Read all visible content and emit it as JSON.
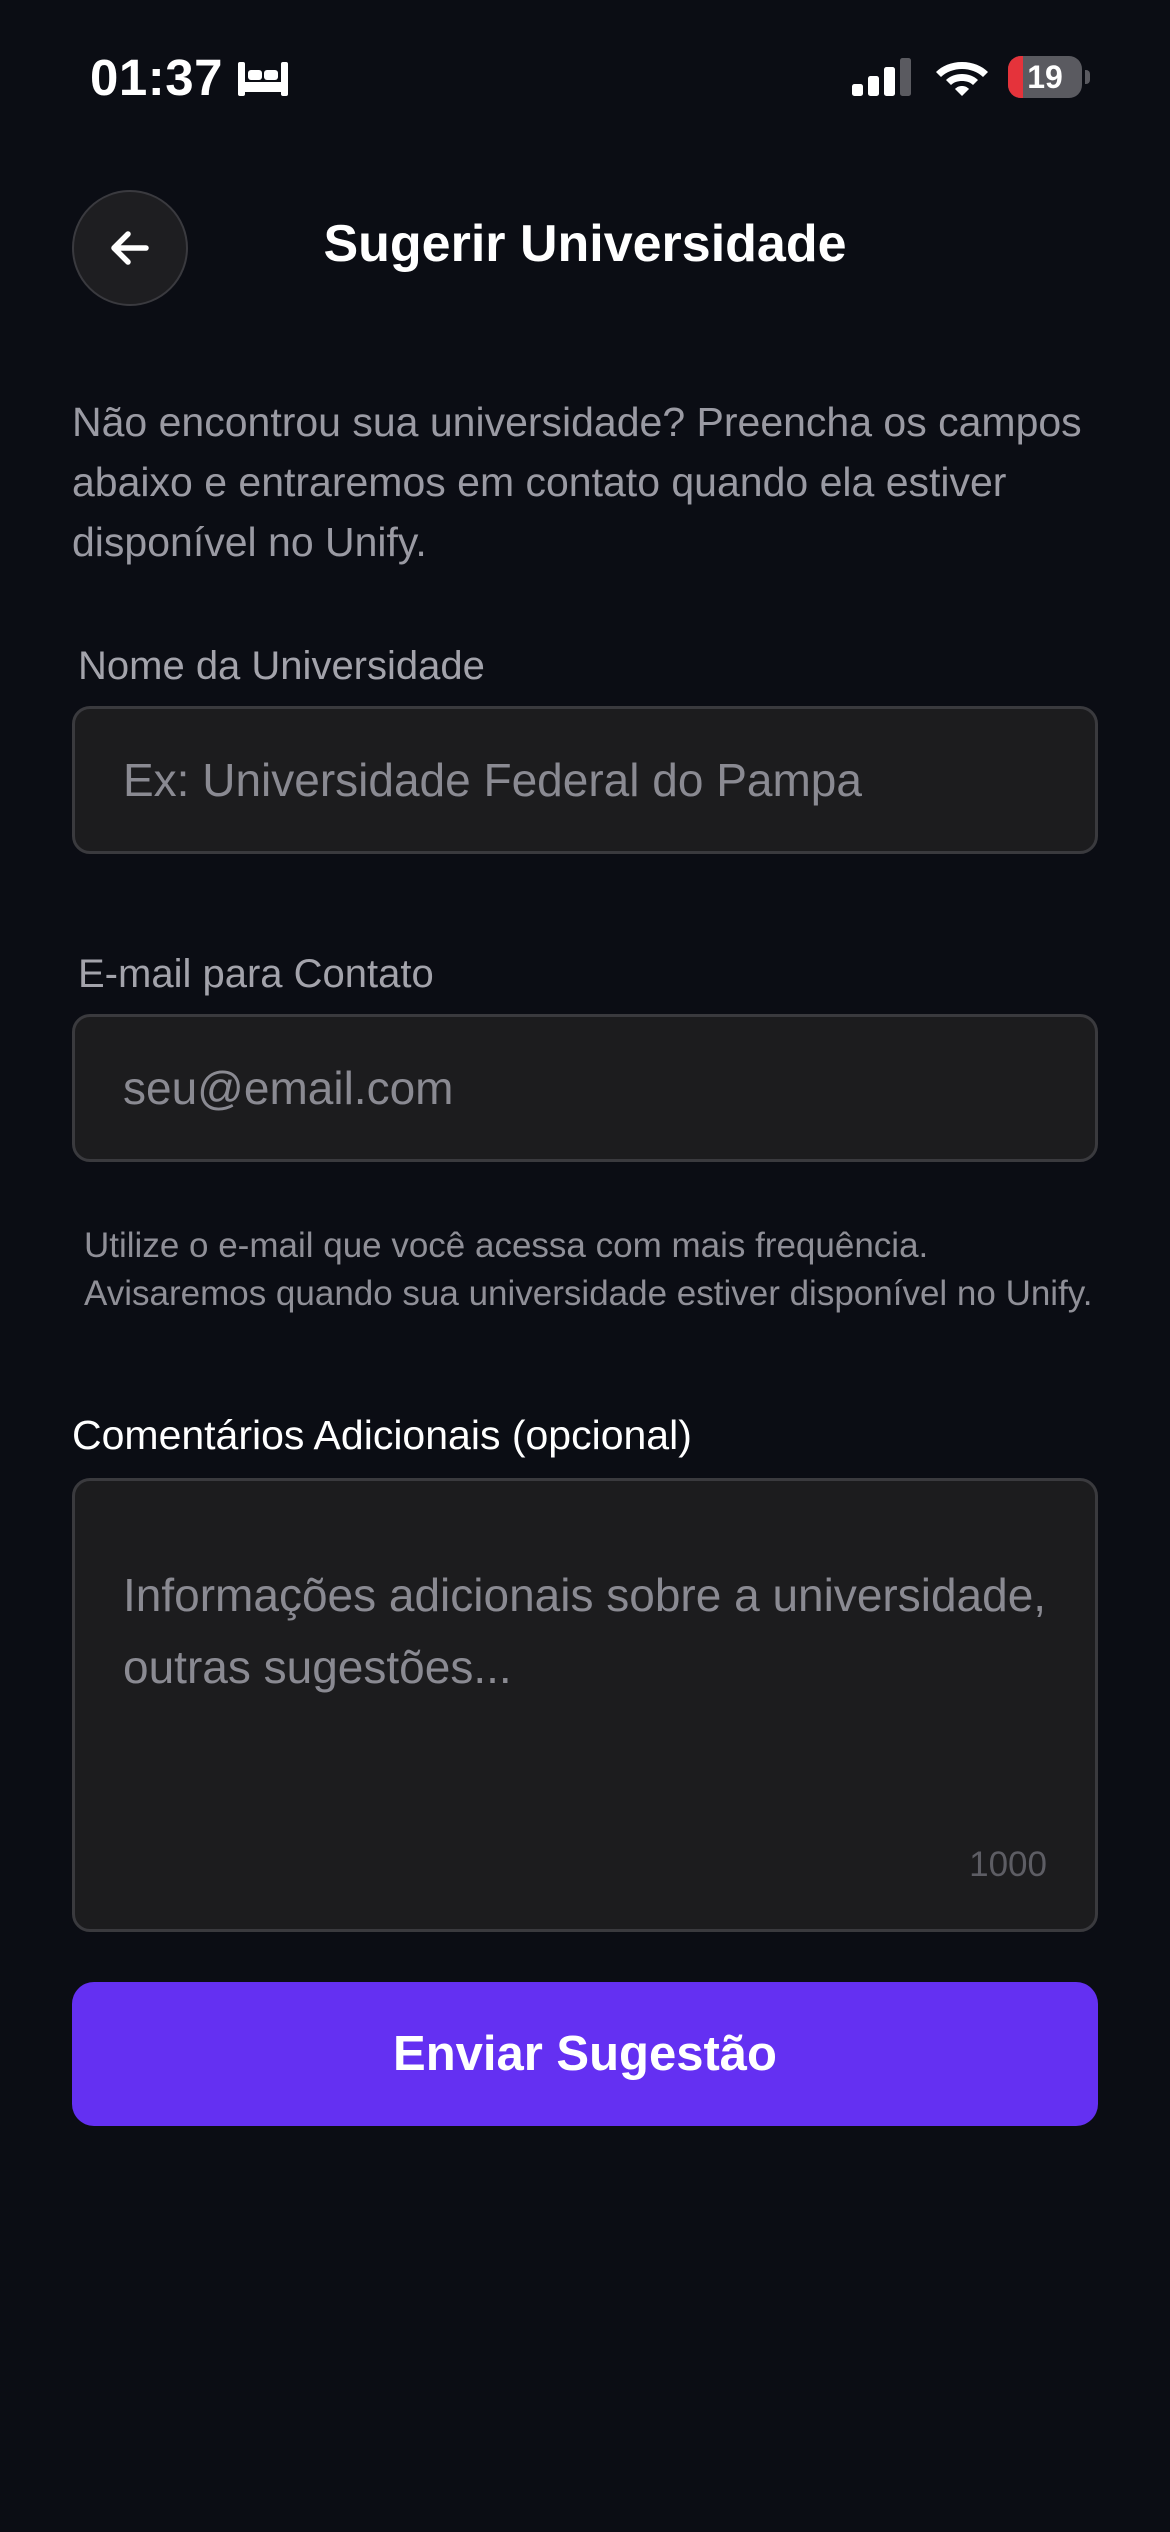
{
  "status_bar": {
    "time": "01:37",
    "battery_level": "19",
    "icons": [
      "bed-sleep-icon",
      "cellular-signal-icon",
      "wifi-icon",
      "battery-icon"
    ]
  },
  "header": {
    "title": "Sugerir Universidade",
    "back_icon": "arrow-left-icon"
  },
  "intro": "Não encontrou sua universidade? Preencha os campos abaixo e entraremos em contato quando ela estiver disponível no Unify.",
  "form": {
    "university": {
      "label": "Nome da Universidade",
      "value": "",
      "placeholder": "Ex: Universidade Federal do Pampa"
    },
    "email": {
      "label": "E-mail para Contato",
      "value": "",
      "placeholder": "seu@email.com",
      "helper": "Utilize o e-mail que você acessa com mais frequência. Avisaremos quando sua universidade estiver disponível no Unify."
    },
    "comments": {
      "label": "Comentários Adicionais (opcional)",
      "value": "",
      "placeholder": "Informações adicionais sobre a universidade, outras sugestões...",
      "counter": "1000"
    },
    "submit_label": "Enviar Sugestão"
  },
  "colors": {
    "background": "#0b0d14",
    "input_background": "#1c1c1e",
    "accent": "#6430f2",
    "battery_low": "#e5333b"
  }
}
